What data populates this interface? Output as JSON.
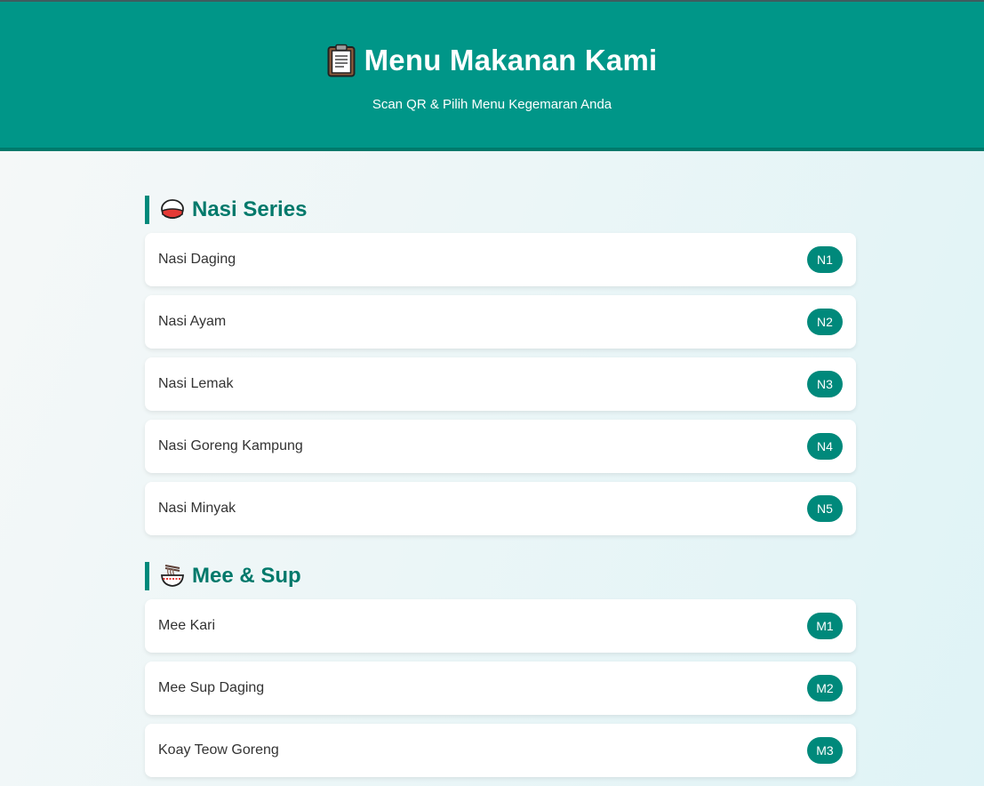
{
  "header": {
    "title": "Menu Makanan Kami",
    "subtitle": "Scan QR & Pilih Menu Kegemaran Anda",
    "icon": "clipboard-icon"
  },
  "colors": {
    "primary": "#009688",
    "primary_dark": "#00796b",
    "badge": "#00897b",
    "card": "#ffffff",
    "text": "#333333"
  },
  "sections": [
    {
      "title": "Nasi Series",
      "icon": "rice-bowl-icon",
      "items": [
        {
          "name": "Nasi Daging",
          "code": "N1"
        },
        {
          "name": "Nasi Ayam",
          "code": "N2"
        },
        {
          "name": "Nasi Lemak",
          "code": "N3"
        },
        {
          "name": "Nasi Goreng Kampung",
          "code": "N4"
        },
        {
          "name": "Nasi Minyak",
          "code": "N5"
        }
      ]
    },
    {
      "title": "Mee & Sup",
      "icon": "noodle-bowl-icon",
      "items": [
        {
          "name": "Mee Kari",
          "code": "M1"
        },
        {
          "name": "Mee Sup Daging",
          "code": "M2"
        },
        {
          "name": "Koay Teow Goreng",
          "code": "M3"
        }
      ]
    }
  ]
}
